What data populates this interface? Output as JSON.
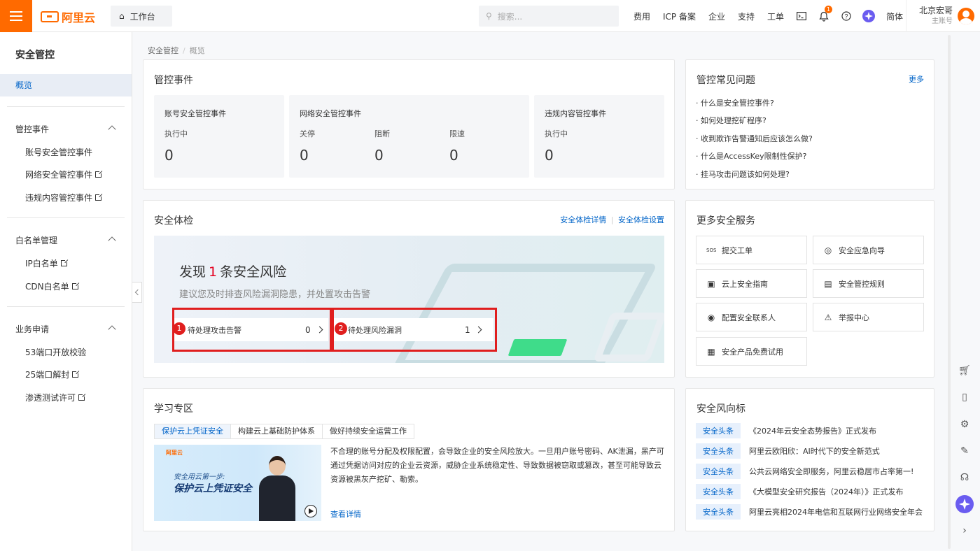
{
  "header": {
    "logo_text": "阿里云",
    "workbench": "工作台",
    "search_placeholder": "搜索...",
    "nav": [
      "费用",
      "ICP 备案",
      "企业",
      "支持",
      "工单"
    ],
    "notification_count": "1",
    "language": "简体",
    "user_name": "北京宏哥",
    "user_role": "主账号"
  },
  "sidebar": {
    "title": "安全管控",
    "active": "概览",
    "groups": [
      {
        "label": "管控事件",
        "items": [
          "账号安全管控事件",
          "网络安全管控事件",
          "违规内容管控事件"
        ]
      },
      {
        "label": "白名单管理",
        "items": [
          "IP白名单",
          "CDN白名单"
        ]
      },
      {
        "label": "业务申请",
        "items": [
          "53端口开放校验",
          "25端口解封",
          "渗透测试许可"
        ]
      }
    ]
  },
  "breadcrumb": {
    "root": "安全管控",
    "sep": "/",
    "current": "概览"
  },
  "events": {
    "title": "管控事件",
    "account": {
      "title": "账号安全管控事件",
      "label": "执行中",
      "value": "0"
    },
    "network": {
      "title": "网络安全管控事件",
      "labels": [
        "关停",
        "阻断",
        "限速"
      ],
      "values": [
        "0",
        "0",
        "0"
      ]
    },
    "content": {
      "title": "违规内容管控事件",
      "label": "执行中",
      "value": "0"
    }
  },
  "checkup": {
    "title": "安全体检",
    "detail_link": "安全体检详情",
    "link_sep": "|",
    "settings_link": "安全体检设置",
    "headline_pre": "发现",
    "risk_count": "1",
    "headline_post": "条安全风险",
    "subtitle": "建议您及时排查风险漏洞隐患，并处置攻击告警",
    "pending_attacks": {
      "label": "待处理攻击告警",
      "count": "0",
      "marker": "1"
    },
    "pending_vulns": {
      "label": "待处理风险漏洞",
      "count": "1",
      "marker": "2"
    }
  },
  "faq": {
    "title": "管控常见问题",
    "more": "更多",
    "items": [
      "什么是安全管控事件?",
      "如何处理挖矿程序?",
      "收到欺诈告警通知后应该怎么做?",
      "什么是AccessKey限制性保护?",
      "挂马攻击问题该如何处理?"
    ]
  },
  "services": {
    "title": "更多安全服务",
    "items": [
      "提交工单",
      "安全应急向导",
      "云上安全指南",
      "安全管控规则",
      "配置安全联系人",
      "举报中心",
      "安全产品免费试用"
    ],
    "sos_label": "SOS"
  },
  "learning": {
    "title": "学习专区",
    "tabs": [
      "保护云上凭证安全",
      "构建云上基础防护体系",
      "做好持续安全运营工作"
    ],
    "video_logo": "阿里云",
    "video_line1": "安全用云第一步:",
    "video_line2": "保护云上凭证安全",
    "text": "不合理的账号分配及权限配置，会导致企业的安全风险放大。一旦用户账号密码、AK泄漏，黑产可通过凭据访问对应的企业云资源，威胁企业系统稳定性、导致数据被窃取或篡改，甚至可能导致云资源被黑灰产挖矿、勒索。",
    "more": "查看详情"
  },
  "news": {
    "title": "安全风向标",
    "tag": "安全头条",
    "items": [
      "《2024年云安全态势报告》正式发布",
      "阿里云欧阳欣：AI时代下的安全新范式",
      "公共云网络安全即服务，阿里云稳居市占率第一!",
      "《大模型安全研究报告（2024年）》正式发布",
      "阿里云亮相2024年电信和互联网行业网络安全年会"
    ]
  },
  "colors": {
    "brand": "#ff6a00",
    "link": "#0064c8",
    "alert": "#e01e1e"
  }
}
